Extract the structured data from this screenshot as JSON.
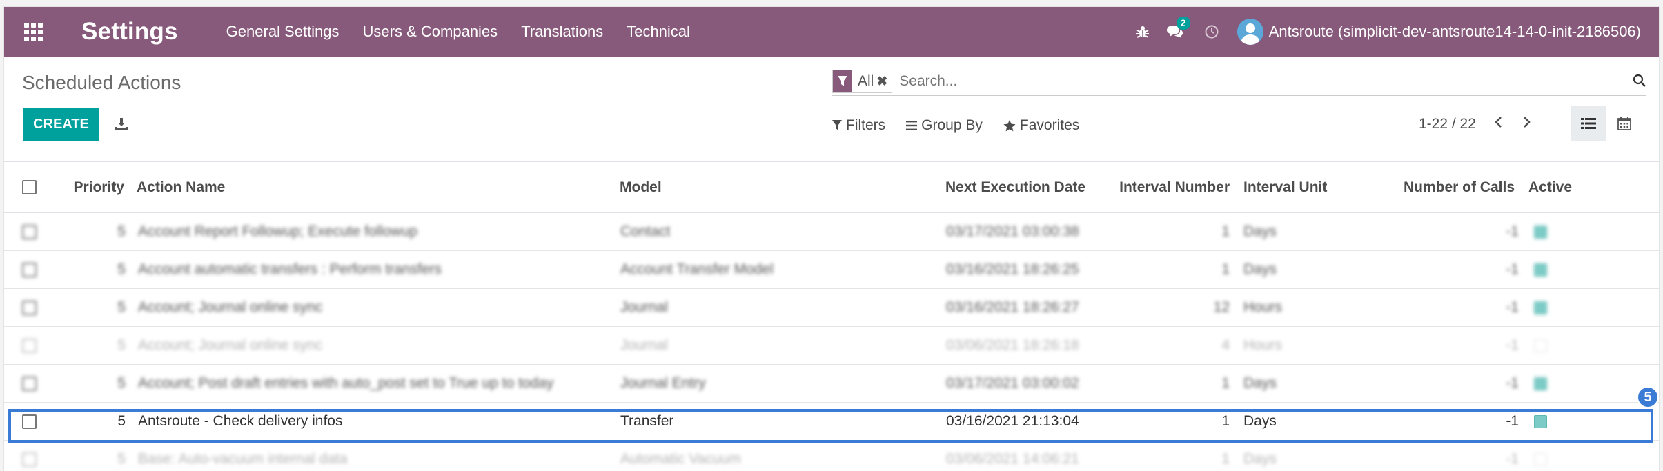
{
  "navbar": {
    "brand": "Settings",
    "menu": [
      "General Settings",
      "Users & Companies",
      "Translations",
      "Technical"
    ],
    "chat_badge": "2",
    "user_name": "Antsroute (simplicit-dev-antsroute14-14-0-init-2186506)",
    "bg_color": "#875a7b"
  },
  "control": {
    "title": "Scheduled Actions",
    "create_label": "CREATE",
    "facet_label": "All",
    "search_placeholder": "Search...",
    "filters_label": "Filters",
    "groupby_label": "Group By",
    "favorites_label": "Favorites",
    "pager": "1-22 / 22",
    "accent_color": "#00a09d"
  },
  "table": {
    "headers": {
      "priority": "Priority",
      "action_name": "Action Name",
      "model": "Model",
      "next_execution": "Next Execution Date",
      "interval_number": "Interval Number",
      "interval_unit": "Interval Unit",
      "number_of_calls": "Number of Calls",
      "active": "Active"
    },
    "rows": [
      {
        "priority": "5",
        "name": "Account Report Followup; Execute followup",
        "model": "Contact",
        "next": "03/17/2021 03:00:38",
        "interval": "1",
        "unit": "Days",
        "calls": "-1",
        "active": true
      },
      {
        "priority": "5",
        "name": "Account automatic transfers : Perform transfers",
        "model": "Account Transfer Model",
        "next": "03/16/2021 18:26:25",
        "interval": "1",
        "unit": "Days",
        "calls": "-1",
        "active": true
      },
      {
        "priority": "5",
        "name": "Account; Journal online sync",
        "model": "Journal",
        "next": "03/16/2021 18:26:27",
        "interval": "12",
        "unit": "Hours",
        "calls": "-1",
        "active": true
      },
      {
        "priority": "5",
        "name": "Account; Journal online sync",
        "model": "Journal",
        "next": "03/06/2021 18:26:18",
        "interval": "4",
        "unit": "Hours",
        "calls": "-1",
        "active": false
      },
      {
        "priority": "5",
        "name": "Account; Post draft entries with auto_post set to True up to today",
        "model": "Journal Entry",
        "next": "03/17/2021 03:00:02",
        "interval": "1",
        "unit": "Days",
        "calls": "-1",
        "active": true
      },
      {
        "priority": "5",
        "name": "Antsroute - Check delivery infos",
        "model": "Transfer",
        "next": "03/16/2021 21:13:04",
        "interval": "1",
        "unit": "Days",
        "calls": "-1",
        "active": true
      },
      {
        "priority": "5",
        "name": "Base: Auto-vacuum internal data",
        "model": "Automatic Vacuum",
        "next": "03/06/2021 14:06:21",
        "interval": "1",
        "unit": "Days",
        "calls": "-1",
        "active": false
      }
    ]
  },
  "annotation": {
    "step": "5",
    "color": "#3a7bd5"
  }
}
